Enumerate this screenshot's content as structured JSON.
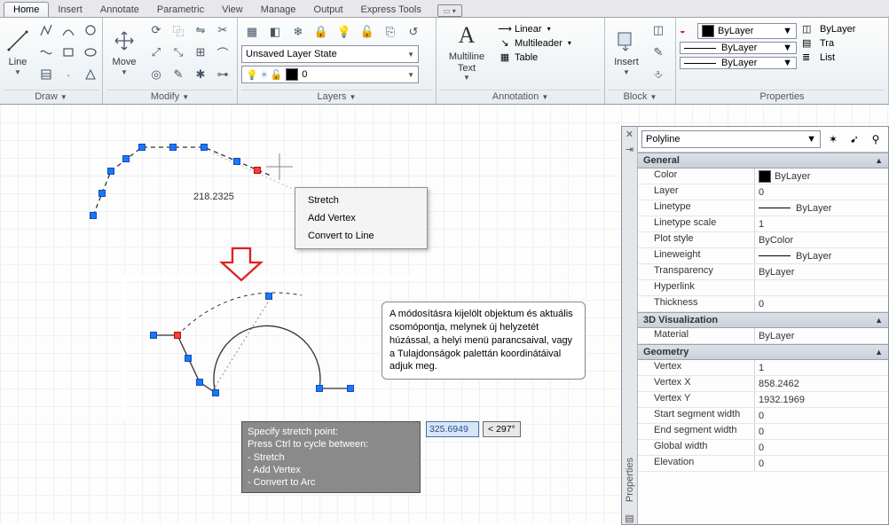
{
  "tabs": {
    "items": [
      "Home",
      "Insert",
      "Annotate",
      "Parametric",
      "View",
      "Manage",
      "Output",
      "Express Tools"
    ],
    "active": 0
  },
  "ribbon": {
    "draw": {
      "title": "Draw",
      "line": "Line"
    },
    "modify": {
      "title": "Modify",
      "move": "Move"
    },
    "layers": {
      "title": "Layers",
      "state": "Unsaved Layer State",
      "current": "0"
    },
    "annotation": {
      "title": "Annotation",
      "mline": "Multiline Text",
      "linear": "Linear",
      "mleader": "Multileader",
      "table": "Table"
    },
    "block": {
      "title": "Block",
      "insert": "Insert"
    },
    "properties": {
      "title": "Properties",
      "bylayer": "ByLayer",
      "list": "List",
      "tra": "Tra"
    }
  },
  "canvas": {
    "dim": "218.2325",
    "context": [
      "Stretch",
      "Add Vertex",
      "Convert to Line"
    ],
    "tooltip": "A módosításra kijelölt objektum és aktuális csomópontja, melynek új helyzetét húzással, a helyi menü parancsaival, vagy a Tulajdonságok palettán koordinátáival adjuk meg.",
    "prompt_title": "Specify stretch point:",
    "prompt_sub": "Press Ctrl to cycle between:",
    "prompt_opts": [
      " - Stretch",
      " - Add Vertex",
      " - Convert to Arc"
    ],
    "dyn_val": "325.6949",
    "dyn_ang": "< 297°"
  },
  "palette": {
    "label": "Properties",
    "type": "Polyline",
    "general": {
      "title": "General",
      "rows": {
        "Color": "ByLayer",
        "Layer": "0",
        "Linetype": "ByLayer",
        "Linetype scale": "1",
        "Plot style": "ByColor",
        "Lineweight": "ByLayer",
        "Transparency": "ByLayer",
        "Hyperlink": "",
        "Thickness": "0"
      }
    },
    "viz": {
      "title": "3D Visualization",
      "rows": {
        "Material": "ByLayer"
      }
    },
    "geom": {
      "title": "Geometry",
      "rows": {
        "Vertex": "1",
        "Vertex X": "858.2462",
        "Vertex Y": "1932.1969",
        "Start segment width": "0",
        "End segment width": "0",
        "Global width": "0",
        "Elevation": "0"
      }
    }
  }
}
